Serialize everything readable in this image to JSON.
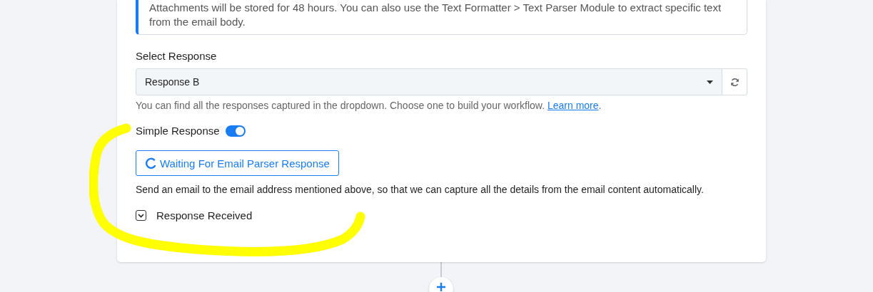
{
  "info_note": {
    "text": "Attachments will be stored for 48 hours. You can also use the Text Formatter > Text Parser Module to extract specific text from the email body."
  },
  "select_response": {
    "label": "Select Response",
    "value": "Response B",
    "helper": "You can find all the responses captured in the dropdown. Choose one to build your workflow.",
    "link": "Learn more",
    "after_link": "."
  },
  "simple_response": {
    "label": "Simple Response",
    "on": true
  },
  "waiting_button": {
    "label": "Waiting For Email Parser Response"
  },
  "instructions": "Send an email to the email address mentioned above, so that we can capture all the details from the email content automatically.",
  "response_received": {
    "label": "Response Received",
    "expanded": false
  }
}
